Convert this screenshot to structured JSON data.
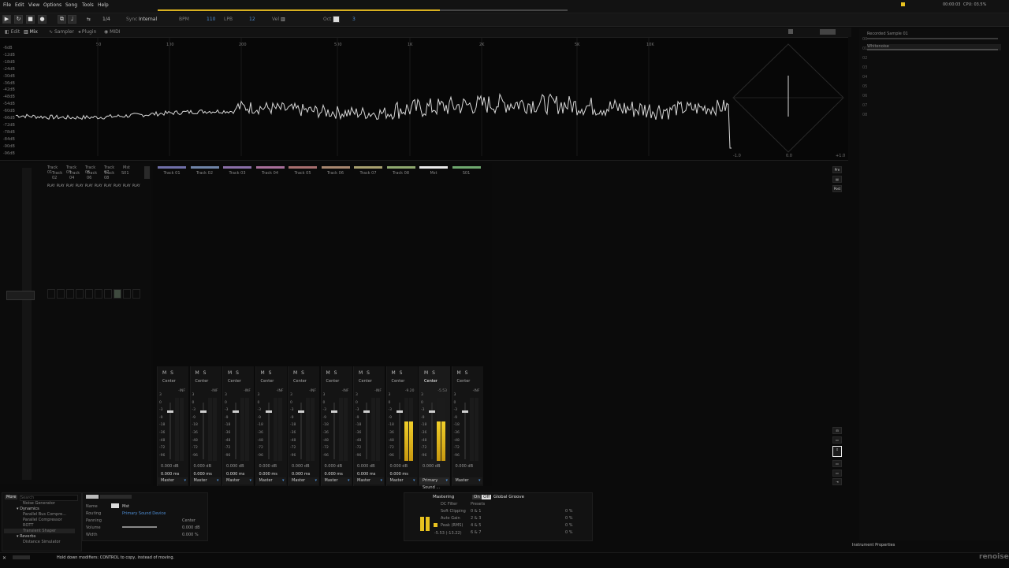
{
  "menu": {
    "items": [
      "File",
      "Edit",
      "View",
      "Options",
      "Song",
      "Tools",
      "Help"
    ]
  },
  "header_right": {
    "time": "00:00:03",
    "cpu": "CPU: 03.5%"
  },
  "toolbar": {
    "sync_label": "Sync",
    "sync_value": "Internal",
    "bpm_label": "BPM",
    "bpm_value": "110",
    "lpb_label": "LPB",
    "lpb_value": "12",
    "vel_label": "Vel",
    "oct_label": "Oct",
    "oct_value": "3",
    "pattern_value": "1/4"
  },
  "tabs": [
    "Edit",
    "Mix",
    "Sampler",
    "Plugin",
    "MIDI"
  ],
  "spectrum": {
    "db_labels": [
      "-6dB",
      "-12dB",
      "-18dB",
      "-24dB",
      "-30dB",
      "-36dB",
      "-42dB",
      "-48dB",
      "-54dB",
      "-60dB",
      "-66dB",
      "-72dB",
      "-78dB",
      "-84dB",
      "-90dB",
      "-96dB"
    ],
    "freq_labels": [
      "50",
      "100",
      "200",
      "500",
      "1K",
      "2K",
      "5K",
      "10K"
    ],
    "scope_labels": [
      "-1.0",
      "0.0",
      "+1.0"
    ]
  },
  "instruments": {
    "items": [
      "Recorded Sample 01",
      "Whitenoise"
    ]
  },
  "left_tracks": {
    "top_names": [
      "Track 01",
      "Track 03",
      "Track 05",
      "Track 07",
      "Mst"
    ],
    "bottom_names": [
      "Track 02",
      "Track 04",
      "Track 06",
      "Track 08",
      "S01"
    ],
    "play_label": "PLAY"
  },
  "mixer": {
    "tracks": [
      {
        "name": "Track 01",
        "color": "#6f6fa8",
        "pan": "Center",
        "peak": "-INF",
        "db": "0.000 dB",
        "ms": "0.000 ms",
        "route": "Master",
        "level": 0
      },
      {
        "name": "Track 02",
        "color": "#6f84a8",
        "pan": "Center",
        "peak": "-INF",
        "db": "0.000 dB",
        "ms": "0.000 ms",
        "route": "Master",
        "level": 0
      },
      {
        "name": "Track 03",
        "color": "#8a6fa8",
        "pan": "Center",
        "peak": "-INF",
        "db": "0.000 dB",
        "ms": "0.000 ms",
        "route": "Master",
        "level": 0
      },
      {
        "name": "Track 04",
        "color": "#a86f9a",
        "pan": "Center",
        "peak": "-INF",
        "db": "0.000 dB",
        "ms": "0.000 ms",
        "route": "Master",
        "level": 0
      },
      {
        "name": "Track 05",
        "color": "#a86f6f",
        "pan": "Center",
        "peak": "-INF",
        "db": "0.000 dB",
        "ms": "0.000 ms",
        "route": "Master",
        "level": 0
      },
      {
        "name": "Track 06",
        "color": "#a8876f",
        "pan": "Center",
        "peak": "-INF",
        "db": "0.000 dB",
        "ms": "0.000 ms",
        "route": "Master",
        "level": 0
      },
      {
        "name": "Track 07",
        "color": "#a8a06f",
        "pan": "Center",
        "peak": "-INF",
        "db": "0.000 dB",
        "ms": "0.000 ms",
        "route": "Master",
        "level": 0
      },
      {
        "name": "Track 08",
        "color": "#8fa86f",
        "pan": "Center",
        "peak": "-9.20",
        "db": "0.000 dB",
        "ms": "0.000 ms",
        "route": "Master",
        "level": 0.62
      },
      {
        "name": "Mst",
        "color": "#e8e8e8",
        "pan": "Center",
        "peak": "-5.53",
        "db": "0.000 dB",
        "ms": "",
        "route": "Primary Sound ...",
        "level": 0.62
      },
      {
        "name": "S01",
        "color": "#6fa86f",
        "pan": "Center",
        "peak": "-INF",
        "db": "0.000 dB",
        "ms": "",
        "route": "Master",
        "level": 0
      }
    ],
    "scale": [
      "3",
      "0",
      "-3",
      "-9",
      "-18",
      "-36",
      "-48",
      "-72",
      "-96"
    ]
  },
  "side_buttons": [
    "Pre",
    "Post"
  ],
  "devices": {
    "header": "More",
    "search_placeholder": "Search",
    "items": [
      "Noise Generator",
      "Dynamics",
      "Parallel Bus Compre...",
      "Parallel Compressor",
      "ROTT",
      "Transient Shaper",
      "Reverbs",
      "Distance Simulator"
    ]
  },
  "inst_props": {
    "name_label": "Name",
    "name_value": "Mst",
    "routing_label": "Routing",
    "routing_value": "Primary Sound Device",
    "panning_label": "Panning",
    "panning_value": "Center",
    "volume_label": "Volume",
    "volume_value": "0.000 dB",
    "width_label": "Width",
    "width_value": "0.000 %"
  },
  "mastering": {
    "title": "Mastering",
    "on": "On",
    "off": "Off",
    "groove": "Global Groove",
    "items": [
      "DC Filter",
      "Soft Clipping",
      "Auto Gain",
      "Peak (RMS)"
    ],
    "peak_value": "-5.53 (-13.22)",
    "presets_label": "Presets",
    "presets": [
      "0 & 1",
      "2 & 3",
      "4 & 5",
      "6 & 7"
    ],
    "percents": [
      "0 %",
      "0 %",
      "0 %",
      "0 %"
    ]
  },
  "instrument_properties_label": "Instrument Properties",
  "status": {
    "message": "Hold down modifiers: CONTROL to copy, instead of moving.",
    "brand": "renoise"
  },
  "colors": {
    "accent": "#4f8fd6",
    "meter": "#e8c21f",
    "progress": "#d8b020"
  }
}
